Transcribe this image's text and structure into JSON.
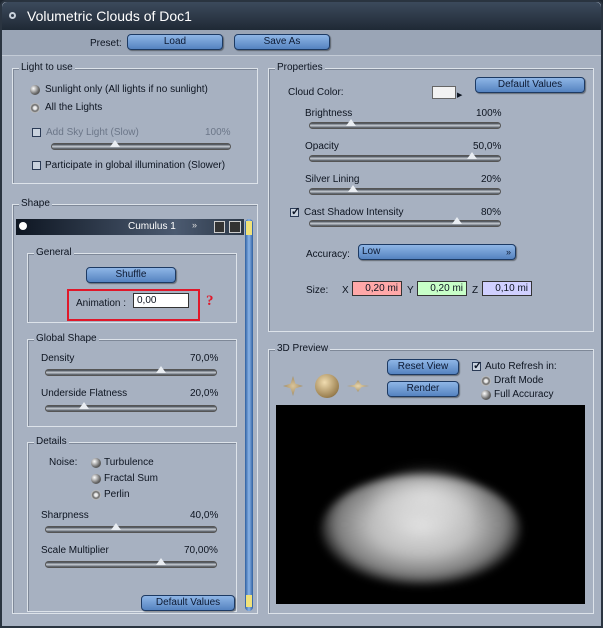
{
  "title": "Volumetric Clouds of Doc1",
  "preset": {
    "label": "Preset:",
    "load": "Load",
    "save_as": "Save As"
  },
  "light": {
    "legend": "Light to use",
    "opt1": "Sunlight only (All lights if no sunlight)",
    "opt2": "All the Lights",
    "sky_label": "Add Sky Light (Slow)",
    "sky_value": "100%",
    "gi_label": "Participate in global illumination (Slower)"
  },
  "shape": {
    "legend": "Shape",
    "preset_name": "Cumulus 1",
    "general": {
      "legend": "General",
      "shuffle": "Shuffle",
      "animation_label": "Animation :",
      "animation_value": "0,00",
      "help": "?"
    },
    "global": {
      "legend": "Global Shape",
      "density_label": "Density",
      "density_value": "70,0%",
      "flatness_label": "Underside Flatness",
      "flatness_value": "20,0%"
    },
    "details": {
      "legend": "Details",
      "noise_label": "Noise:",
      "noise_options": [
        "Turbulence",
        "Fractal Sum",
        "Perlin"
      ],
      "sharpness_label": "Sharpness",
      "sharpness_value": "40,0%",
      "scale_label": "Scale Multiplier",
      "scale_value": "70,00%"
    },
    "default_values": "Default Values"
  },
  "properties": {
    "legend": "Properties",
    "cloud_color_label": "Cloud Color:",
    "default_values": "Default Values",
    "brightness_label": "Brightness",
    "brightness_value": "100%",
    "opacity_label": "Opacity",
    "opacity_value": "50,0%",
    "silver_label": "Silver Lining",
    "silver_value": "20%",
    "shadow_label": "Cast Shadow Intensity",
    "shadow_value": "80%",
    "accuracy_label": "Accuracy:",
    "accuracy_value": "Low",
    "size_label": "Size:",
    "x_label": "X",
    "x_value": "0,20 mi",
    "y_label": "Y",
    "y_value": "0,20 mi",
    "z_label": "Z",
    "z_value": "0,10 mi",
    "colors": {
      "x": "#ffa8a8",
      "y": "#c8ffc8",
      "z": "#d0d0ff"
    }
  },
  "preview": {
    "legend": "3D Preview",
    "reset_view": "Reset View",
    "render": "Render",
    "auto_refresh": "Auto Refresh in:",
    "draft": "Draft Mode",
    "full": "Full Accuracy"
  }
}
